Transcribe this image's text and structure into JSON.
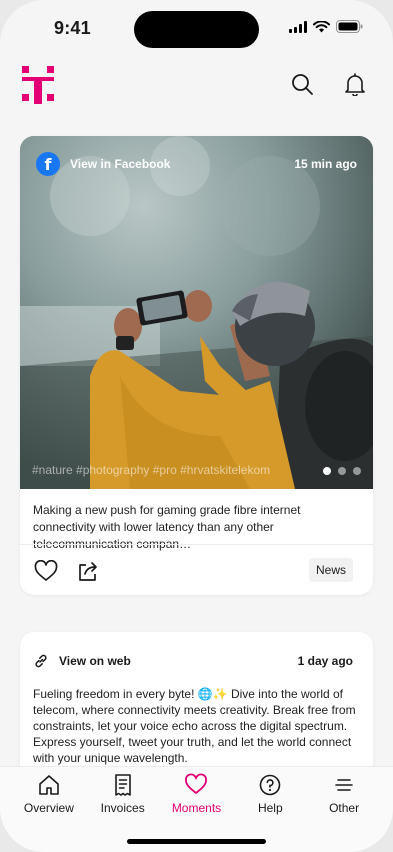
{
  "status_bar": {
    "time": "9:41"
  },
  "header": {
    "brand_color": "#e20074",
    "icons": [
      "search-icon",
      "bell-icon"
    ]
  },
  "post1": {
    "source_label": "View in Facebook",
    "time": "15 min ago",
    "tags": "#nature #photography #pro #hrvatskitelekom",
    "caption": "Making a new push for gaming grade fibre internet connectivity with lower latency than any other telecommunication compan…",
    "badge": "News",
    "carousel": {
      "count": 3,
      "active_index": 0
    }
  },
  "post2": {
    "source_label": "View on web",
    "time": "1 day ago",
    "text": "Fueling freedom in every byte! 🌐✨ Dive into the world of telecom, where connectivity meets creativity. Break free from constraints, let your voice echo across the digital spectrum. Express yourself, tweet your truth, and let the world connect with your unique wavelength."
  },
  "nav": {
    "items": [
      {
        "label": "Overview",
        "icon": "home-icon"
      },
      {
        "label": "Invoices",
        "icon": "invoice-icon"
      },
      {
        "label": "Moments",
        "icon": "heart-icon",
        "active": true
      },
      {
        "label": "Help",
        "icon": "help-icon"
      },
      {
        "label": "Other",
        "icon": "menu-icon"
      }
    ],
    "active_color": "#e20074"
  }
}
